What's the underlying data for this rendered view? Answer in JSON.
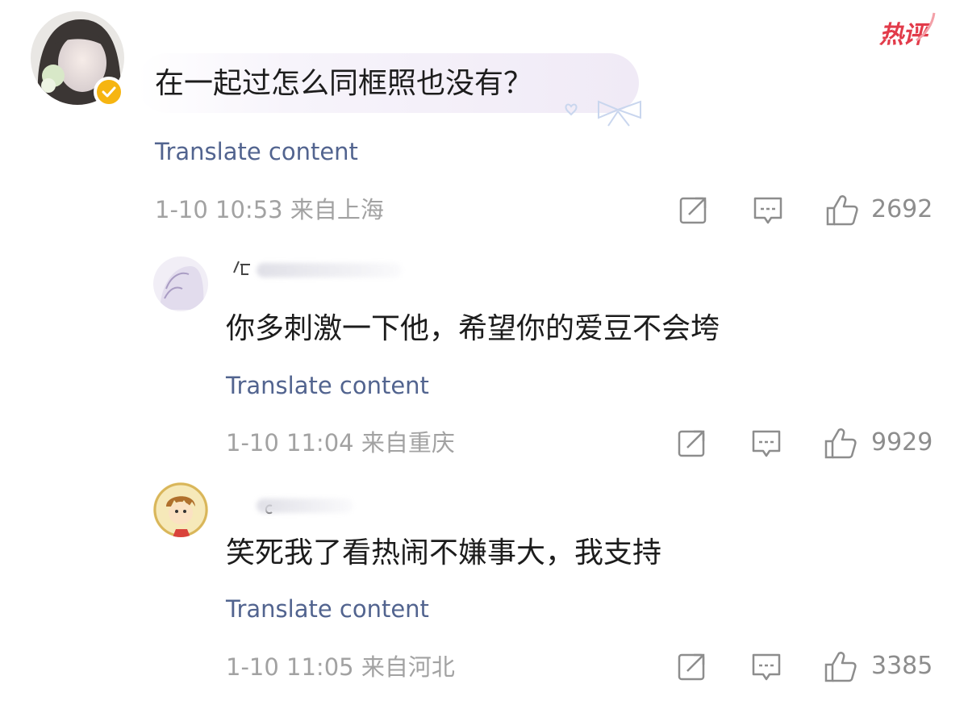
{
  "hot_badge": {
    "label": "热评",
    "color": "#e23b4a"
  },
  "main_comment": {
    "text": "在一起过怎么同框照也没有？",
    "translate": "Translate content",
    "meta": "1-10 10:53 来自上海",
    "likes": "2692",
    "verified_badge_color": "#f6b511"
  },
  "replies": [
    {
      "text": "你多刺激一下他，希望你的爱豆不会垮",
      "translate": "Translate content",
      "meta": "1-10 11:04 来自重庆",
      "likes": "9929"
    },
    {
      "text": "笑死我了看热闹不嫌事大，我支持",
      "translate": "Translate content",
      "meta": "1-10 11:05 来自河北",
      "likes": "3385"
    }
  ],
  "icons": {
    "share": "share-icon",
    "comment": "comment-icon",
    "like": "thumbs-up-icon"
  },
  "colors": {
    "translate_link": "#52648f",
    "meta_text": "#a2a2a2"
  }
}
